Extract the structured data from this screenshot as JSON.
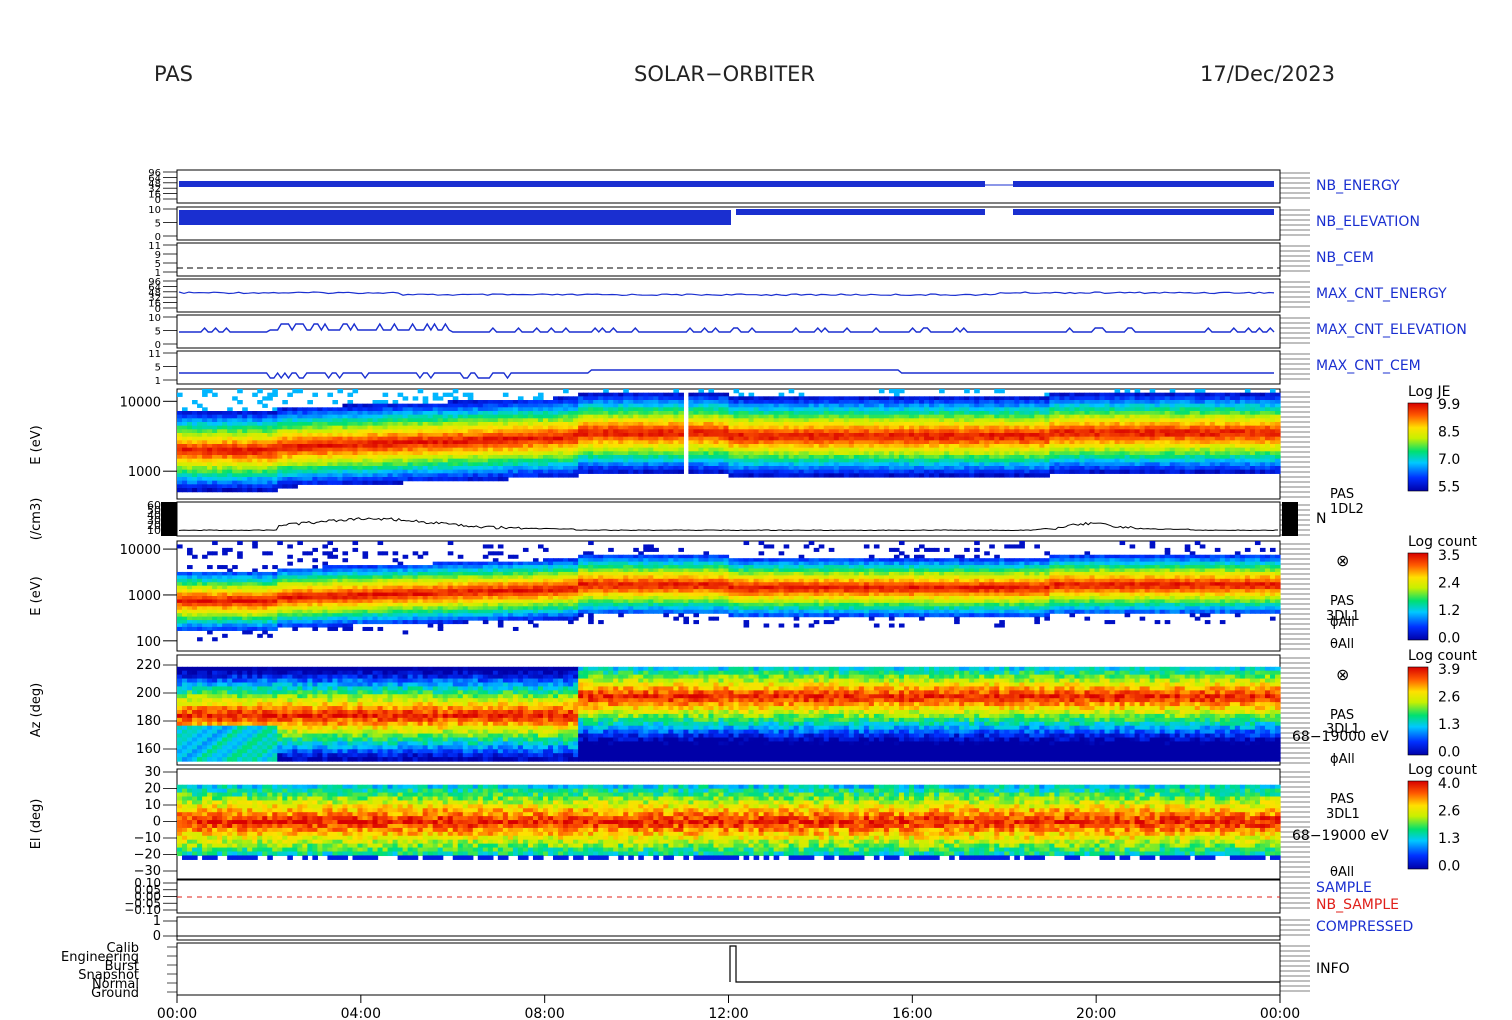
{
  "header": {
    "instrument": "PAS",
    "mission": "SOLAR−ORBITER",
    "date": "17/Dec/2023"
  },
  "colors": {
    "trace_blue": "#1a2fd0",
    "label_blue": "#1a2fd0",
    "label_red": "#e0201a",
    "black": "#000000"
  },
  "chart_data": {
    "type": "heatmap",
    "x_axis": {
      "range": [
        "00:00",
        "24:00"
      ],
      "tick_labels": [
        "00:00",
        "04:00",
        "08:00",
        "12:00",
        "16:00",
        "20:00",
        "00:00"
      ]
    },
    "panels": [
      {
        "id": "nb_energy",
        "label": "NB_ENERGY",
        "label_color": "blue",
        "type": "line",
        "tick_labels": [
          "96",
          "64",
          "48",
          "32",
          "16",
          "0"
        ]
      },
      {
        "id": "nb_elevation",
        "label": "NB_ELEVATION",
        "label_color": "blue",
        "type": "line",
        "tick_labels": [
          "10",
          "5",
          "0"
        ]
      },
      {
        "id": "nb_cem",
        "label": "NB_CEM",
        "label_color": "blue",
        "type": "line",
        "tick_labels": [
          "11",
          "9",
          "5",
          "1"
        ]
      },
      {
        "id": "max_cnt_energy",
        "label": "MAX_CNT_ENERGY",
        "label_color": "blue",
        "type": "line",
        "tick_labels": [
          "96",
          "64",
          "48",
          "32",
          "16",
          "0"
        ]
      },
      {
        "id": "max_cnt_elevation",
        "label": "MAX_CNT_ELEVATION",
        "label_color": "blue",
        "type": "line",
        "tick_labels": [
          "10",
          "5",
          "0"
        ]
      },
      {
        "id": "max_cnt_cem",
        "label": "MAX_CNT_CEM",
        "label_color": "blue",
        "type": "line",
        "tick_labels": [
          "11",
          "5",
          "1"
        ]
      },
      {
        "id": "energy_je",
        "type": "heatmap",
        "ylabel": "E (eV)",
        "yscale": "log",
        "ylim": [
          400,
          15000
        ],
        "tick_labels": [
          "10000",
          "1000"
        ],
        "colorbar": {
          "title": "Log JE",
          "ticks": [
            "9.9",
            "8.5",
            "7.0",
            "5.5"
          ],
          "range": [
            5.5,
            9.9
          ]
        }
      },
      {
        "id": "density",
        "type": "line",
        "ylabel": "(/cm3)",
        "ylim": [
          0,
          60
        ],
        "tick_labels": [
          "60",
          "50",
          "40",
          "30",
          "20",
          "10"
        ],
        "side_labels": [
          "PAS",
          "1DL2",
          "N"
        ]
      },
      {
        "id": "energy_counts",
        "type": "heatmap",
        "ylabel": "E (eV)",
        "yscale": "log",
        "ylim": [
          60,
          15000
        ],
        "tick_labels": [
          "10000",
          "1000",
          "100"
        ],
        "colorbar": {
          "title": "Log count",
          "ticks": [
            "3.5",
            "2.4",
            "1.2",
            "0.0"
          ],
          "range": [
            0.0,
            3.5
          ]
        },
        "side_labels": [
          "⊗",
          "PAS",
          "3DL1",
          "ϕAll",
          "θAll"
        ]
      },
      {
        "id": "azimuth",
        "type": "heatmap",
        "ylabel": "Az (deg)",
        "ylim": [
          155,
          225
        ],
        "tick_labels": [
          "220",
          "200",
          "180",
          "160"
        ],
        "colorbar": {
          "title": "Log count",
          "ticks": [
            "3.9",
            "2.6",
            "1.3",
            "0.0"
          ],
          "range": [
            0.0,
            3.9
          ]
        },
        "side_labels": [
          "⊗",
          "PAS",
          "3DL1",
          "68−19000 eV",
          "ϕAll"
        ]
      },
      {
        "id": "elevation",
        "type": "heatmap",
        "ylabel": "El (deg)",
        "ylim": [
          -30,
          30
        ],
        "tick_labels": [
          "30",
          "20",
          "10",
          "0",
          "−10",
          "−20",
          "−30"
        ],
        "colorbar": {
          "title": "Log count",
          "ticks": [
            "4.0",
            "2.6",
            "1.3",
            "0.0"
          ],
          "range": [
            0.0,
            4.0
          ]
        },
        "side_labels": [
          "PAS",
          "3DL1",
          "68−19000 eV",
          "θAll"
        ]
      },
      {
        "id": "sample",
        "type": "line",
        "tick_labels": [
          "0.10",
          "0.05",
          "0.00",
          "−0.05",
          "−0.10"
        ],
        "labels": [
          {
            "text": "SAMPLE",
            "color": "blue"
          },
          {
            "text": "NB_SAMPLE",
            "color": "red"
          }
        ]
      },
      {
        "id": "compressed",
        "label": "COMPRESSED",
        "label_color": "blue",
        "type": "line",
        "tick_labels": [
          "1",
          "0"
        ]
      },
      {
        "id": "info",
        "label": "INFO",
        "label_color": "black",
        "type": "line",
        "tick_labels": [
          "Calib",
          "Engineering",
          "Burst",
          "Snapshot",
          "Normal",
          "Ground"
        ]
      }
    ]
  }
}
